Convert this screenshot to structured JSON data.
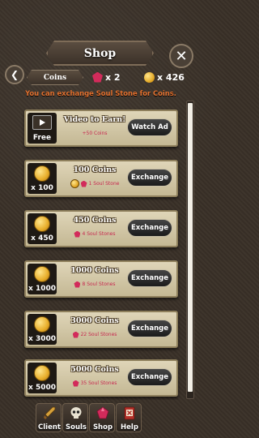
{
  "header": {
    "title": "Shop",
    "close_glyph": "✕",
    "back_glyph": "❮",
    "tab_label": "Coins"
  },
  "currencies": {
    "gems": "x 2",
    "coins": "x 426"
  },
  "info_text": "You can exchange Soul Stone for Coins.",
  "items": [
    {
      "icon": "video-icon",
      "icon_label": "Free",
      "title": "Video to Earn!",
      "subtitle": "+50 Coins",
      "action": "Watch Ad"
    },
    {
      "icon": "coin-icon",
      "icon_label": "x 100",
      "title": "100 Coins",
      "subtitle": "1 Soul Stone",
      "action": "Exchange"
    },
    {
      "icon": "coin-icon",
      "icon_label": "x 450",
      "title": "450 Coins",
      "subtitle": "4 Soul Stones",
      "action": "Exchange"
    },
    {
      "icon": "coin-icon",
      "icon_label": "x 1000",
      "title": "1000 Coins",
      "subtitle": "8 Soul Stones",
      "action": "Exchange"
    },
    {
      "icon": "coin-icon",
      "icon_label": "x 3000",
      "title": "3000 Coins",
      "subtitle": "22 Soul Stones",
      "action": "Exchange"
    },
    {
      "icon": "coin-icon",
      "icon_label": "x 5000",
      "title": "5000 Coins",
      "subtitle": "35 Soul Stones",
      "action": "Exchange"
    }
  ],
  "nav": [
    {
      "label": "Client",
      "icon": "sword-icon"
    },
    {
      "label": "Souls",
      "icon": "skull-icon"
    },
    {
      "label": "Shop",
      "icon": "gem-icon"
    },
    {
      "label": "Help",
      "icon": "book-icon"
    }
  ],
  "colors": {
    "info_text": "#e1702f",
    "card_bg": "#dfd5b8",
    "gem": "#d22b5b",
    "coin": "#e7ad2a"
  }
}
